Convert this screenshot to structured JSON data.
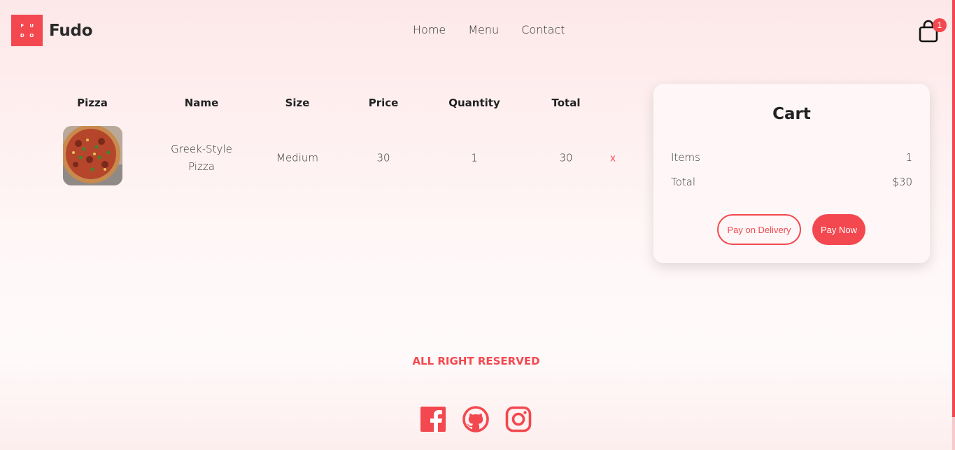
{
  "brand": {
    "logo_letters": [
      "F",
      "U",
      "D",
      "O"
    ],
    "name": "Fudo",
    "accent_color": "#f3484f"
  },
  "nav": {
    "items": [
      {
        "label": "Home"
      },
      {
        "label": "Menu"
      },
      {
        "label": "Contact"
      }
    ]
  },
  "cart_icon": {
    "icon": "shopping-bag-icon",
    "badge_count": "1"
  },
  "table": {
    "headers": [
      "Pizza",
      "Name",
      "Size",
      "Price",
      "Quantity",
      "Total"
    ],
    "rows": [
      {
        "image": "pizza-thumbnail",
        "name": "Greek-Style Pizza",
        "size": "Medium",
        "price": "30",
        "quantity": "1",
        "total": "30",
        "remove_label": "x"
      }
    ]
  },
  "cart": {
    "title": "Cart",
    "items_label": "Items",
    "items_value": "1",
    "total_label": "Total",
    "total_value": "$30",
    "pay_on_delivery_label": "Pay on Delivery",
    "pay_now_label": "Pay Now"
  },
  "footer": {
    "text": "ALL RIGHT RESERVED",
    "socials": [
      "facebook-icon",
      "github-icon",
      "instagram-icon"
    ]
  }
}
